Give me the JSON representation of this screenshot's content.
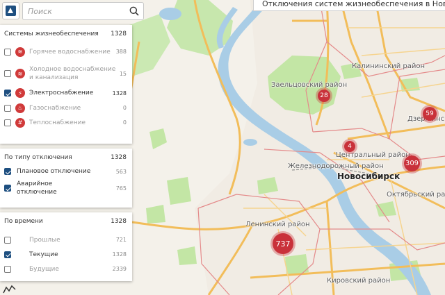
{
  "header": {
    "title": "Отключения систем жизнеобеспечения в Новосибирске"
  },
  "search": {
    "placeholder": "Поиск",
    "value": ""
  },
  "systems_panel": {
    "title": "Системы жизнеобеспечения",
    "total": "1328",
    "items": [
      {
        "label": "Горячее водоснабжение",
        "count": "388",
        "checked": false,
        "icon": "hot-water-icon"
      },
      {
        "label": "Холодное водоснабжение и канализация",
        "count": "15",
        "checked": false,
        "icon": "cold-water-icon"
      },
      {
        "label": "Электроснабжение",
        "count": "1328",
        "checked": true,
        "icon": "lightning-icon"
      },
      {
        "label": "Газоснабжение",
        "count": "0",
        "checked": false,
        "icon": "gas-flame-icon"
      },
      {
        "label": "Теплоснабжение",
        "count": "0",
        "checked": false,
        "icon": "heating-icon"
      }
    ]
  },
  "type_panel": {
    "title": "По типу отключения",
    "total": "1328",
    "items": [
      {
        "label": "Плановое отключение",
        "count": "563",
        "checked": true
      },
      {
        "label": "Аварийное отключение",
        "count": "765",
        "checked": true
      }
    ]
  },
  "time_panel": {
    "title": "По времени",
    "total": "1328",
    "items": [
      {
        "label": "Прошлые",
        "count": "721",
        "checked": false
      },
      {
        "label": "Текущие",
        "count": "1328",
        "checked": true
      },
      {
        "label": "Будущие",
        "count": "2339",
        "checked": false
      }
    ]
  },
  "map": {
    "city_label": "Новосибирск",
    "district_labels": {
      "kalininsky": "Калининский район",
      "zaeltsovsky": "Заельцовский район",
      "dzerzhinsky": "Дзержинс",
      "centralny": "Центральный район",
      "zheleznodorozhny": "Железнодорожный район",
      "oktyabrsky": "Октябрьский район",
      "leninsky": "Ленинский район",
      "kirovsky": "Кировский район"
    },
    "clusters": [
      {
        "id": "zaeltsovsky",
        "count": "28"
      },
      {
        "id": "dzerzhinsky",
        "count": "59"
      },
      {
        "id": "center",
        "count": "4"
      },
      {
        "id": "east",
        "count": "309"
      },
      {
        "id": "leninsky",
        "count": "737"
      }
    ],
    "colors": {
      "water": "#a9cde6",
      "park": "#c3e6a5",
      "road": "#f2bd5a",
      "border": "#e48a8a",
      "cluster": "#c9313a"
    }
  }
}
